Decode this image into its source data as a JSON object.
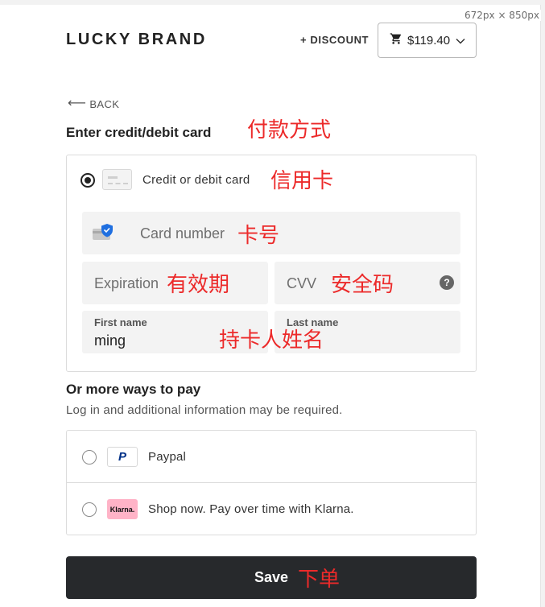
{
  "viewport_label": "672px × 850px",
  "header": {
    "brand": "LUCKY BRAND",
    "discount_label": "+ DISCOUNT",
    "cart_total": "$119.40"
  },
  "back_label": "BACK",
  "card_section": {
    "heading": "Enter credit/debit card",
    "option_label": "Credit or debit card",
    "card_number_placeholder": "Card number",
    "expiration_placeholder": "Expiration",
    "cvv_placeholder": "CVV",
    "first_name_label": "First name",
    "first_name_value": "ming",
    "last_name_label": "Last name",
    "last_name_value": ""
  },
  "more_ways": {
    "heading": "Or more ways to pay",
    "subtext": "Log in and additional information may be required.",
    "options": [
      {
        "label": "Paypal",
        "logo_text": "P"
      },
      {
        "label": "Shop now. Pay over time with Klarna.",
        "logo_text": "Klarna."
      }
    ]
  },
  "save_label": "Save",
  "annotations": {
    "payment_method": "付款方式",
    "credit_card": "信用卡",
    "card_number": "卡号",
    "expiration": "有效期",
    "cvv": "安全码",
    "cardholder": "持卡人姓名",
    "place_order": "下单"
  },
  "colors": {
    "annotation": "#ec2a2a",
    "save_button": "#27292c",
    "field_bg": "#f3f3f3",
    "klarna_pink": "#ffb3c7",
    "paypal_blue": "#003087"
  }
}
